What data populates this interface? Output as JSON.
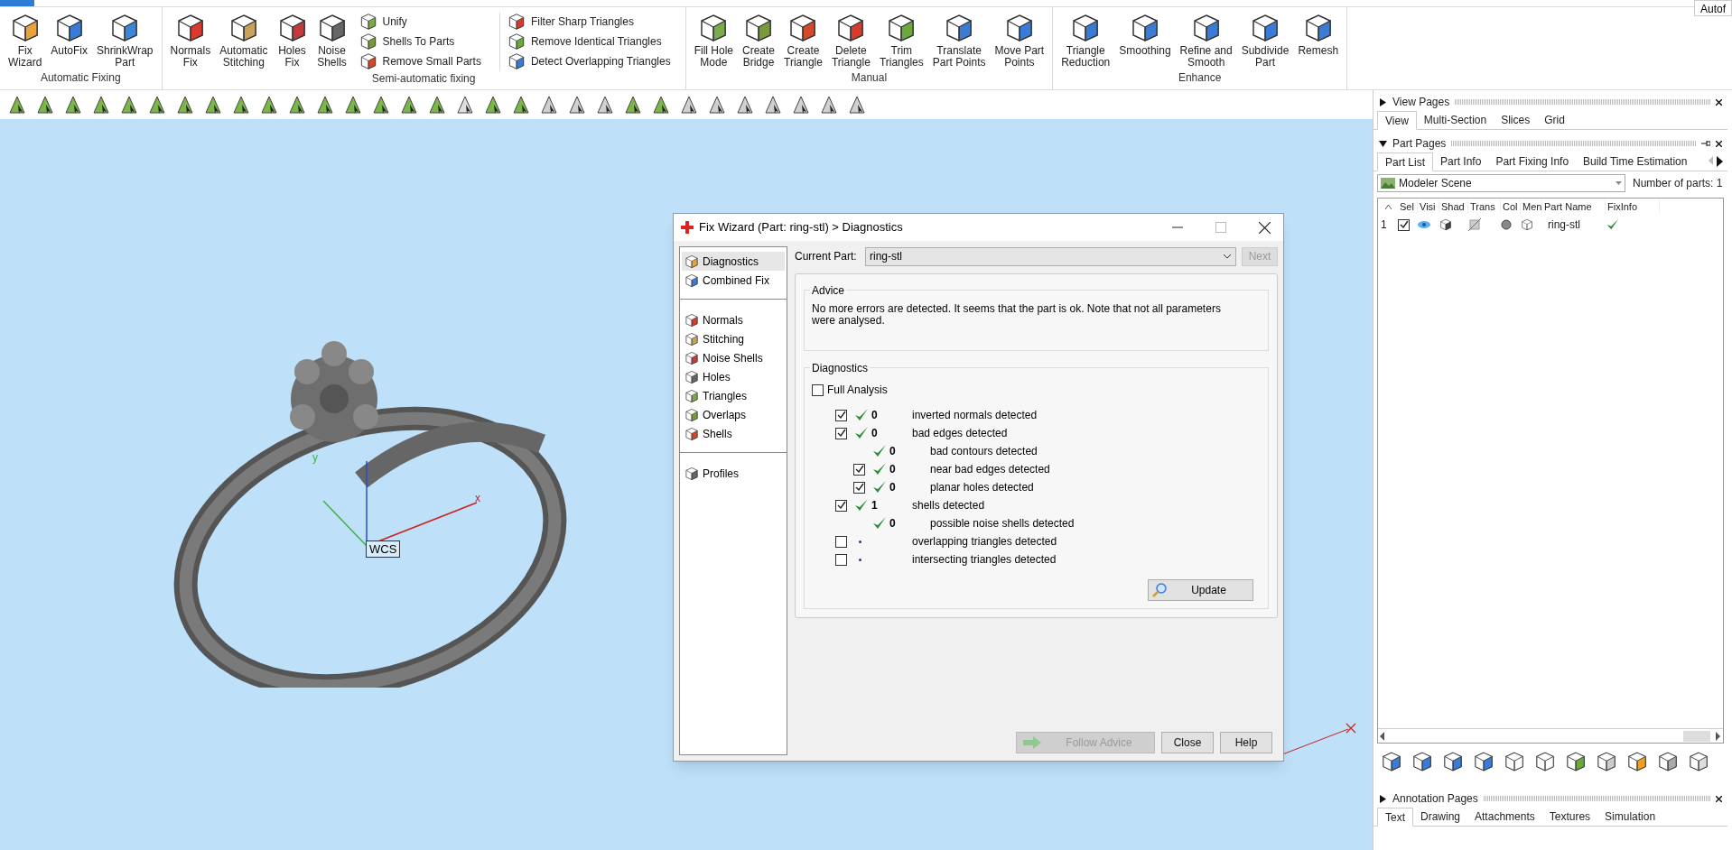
{
  "top_right_tab": "Autof",
  "ribbon": {
    "groups": [
      {
        "label": "Automatic Fixing",
        "large": [
          {
            "lines": [
              "Fix",
              "Wizard"
            ]
          },
          {
            "lines": [
              "AutoFix"
            ]
          },
          {
            "lines": [
              "ShrinkWrap",
              "Part"
            ]
          }
        ]
      },
      {
        "label": "Semi-automatic fixing",
        "large": [
          {
            "lines": [
              "Normals",
              "Fix"
            ]
          },
          {
            "lines": [
              "Automatic",
              "Stitching"
            ]
          },
          {
            "lines": [
              "Holes",
              "Fix"
            ]
          },
          {
            "lines": [
              "Noise",
              "Shells"
            ]
          }
        ],
        "columns": [
          [
            "Unify",
            "Shells To Parts",
            "Remove Small Parts"
          ],
          [
            "Filter Sharp Triangles",
            "Remove Identical Triangles",
            "Detect Overlapping Triangles"
          ]
        ]
      },
      {
        "label": "Manual",
        "large": [
          {
            "lines": [
              "Fill Hole",
              "Mode"
            ]
          },
          {
            "lines": [
              "Create",
              "Bridge"
            ]
          },
          {
            "lines": [
              "Create",
              "Triangle"
            ]
          },
          {
            "lines": [
              "Delete",
              "Triangle"
            ]
          },
          {
            "lines": [
              "Trim",
              "Triangles"
            ]
          },
          {
            "lines": [
              "Translate",
              "Part Points"
            ]
          },
          {
            "lines": [
              "Move Part",
              "Points"
            ]
          }
        ]
      },
      {
        "label": "Enhance",
        "large": [
          {
            "lines": [
              "Triangle",
              "Reduction"
            ]
          },
          {
            "lines": [
              "Smoothing"
            ]
          },
          {
            "lines": [
              "Refine and",
              "Smooth"
            ]
          },
          {
            "lines": [
              "Subdivide",
              "Part"
            ]
          },
          {
            "lines": [
              "Remesh"
            ]
          }
        ]
      }
    ]
  },
  "viewport": {
    "axis_labels": [
      "x",
      "y"
    ],
    "wcs": "WCS"
  },
  "dialog": {
    "title": "Fix Wizard (Part: ring-stl) > Diagnostics",
    "nav": [
      [
        {
          "label": "Diagnostics",
          "selected": true
        },
        {
          "label": "Combined Fix",
          "selected": false
        }
      ],
      [
        {
          "label": "Normals",
          "selected": false
        },
        {
          "label": "Stitching",
          "selected": false
        },
        {
          "label": "Noise Shells",
          "selected": false
        },
        {
          "label": "Holes",
          "selected": false
        },
        {
          "label": "Triangles",
          "selected": false
        },
        {
          "label": "Overlaps",
          "selected": false
        },
        {
          "label": "Shells",
          "selected": false
        }
      ],
      [
        {
          "label": "Profiles",
          "selected": false
        }
      ]
    ],
    "current_part_label": "Current Part:",
    "current_part": "ring-stl",
    "next_button": {
      "label": "Next",
      "disabled": true
    },
    "advice_title": "Advice",
    "advice": "No more errors are detected. It seems that the part is ok. Note that not all parameters were analysed.",
    "diagnostics_title": "Diagnostics",
    "full_analysis": {
      "label": "Full Analysis",
      "checked": false
    },
    "rows": [
      {
        "kind": "check",
        "checked": true,
        "passed": true,
        "count": "0",
        "label": "inverted normals detected"
      },
      {
        "kind": "check",
        "checked": true,
        "passed": true,
        "count": "0",
        "label": "bad edges detected",
        "children": [
          {
            "kind": "plain",
            "passed": true,
            "count": "0",
            "label": "bad contours detected"
          },
          {
            "kind": "check",
            "checked": true,
            "passed": true,
            "count": "0",
            "label": "near bad edges detected"
          },
          {
            "kind": "check",
            "checked": true,
            "passed": true,
            "count": "0",
            "label": "planar holes detected"
          }
        ]
      },
      {
        "kind": "check",
        "checked": true,
        "passed": true,
        "count": "1",
        "label": "shells detected",
        "children": [
          {
            "kind": "plain",
            "passed": true,
            "count": "0",
            "label": "possible noise shells detected"
          }
        ]
      },
      {
        "kind": "check",
        "checked": false,
        "passed": false,
        "label": "overlapping triangles detected"
      },
      {
        "kind": "check",
        "checked": false,
        "passed": false,
        "label": "intersecting triangles detected"
      }
    ],
    "update_button": "Update",
    "footer_buttons": [
      {
        "label": "Follow Advice",
        "disabled": true
      },
      {
        "label": "Close",
        "disabled": false
      },
      {
        "label": "Help",
        "disabled": false
      }
    ]
  },
  "right_panel": {
    "view_pages": {
      "title": "View Pages",
      "expanded": false,
      "tabs": [
        {
          "label": "View",
          "selected": true
        },
        {
          "label": "Multi-Section",
          "selected": false
        },
        {
          "label": "Slices",
          "selected": false
        },
        {
          "label": "Grid",
          "selected": false
        }
      ]
    },
    "part_pages": {
      "title": "Part Pages",
      "expanded": true,
      "tabs": [
        {
          "label": "Part List",
          "selected": true
        },
        {
          "label": "Part Info",
          "selected": false
        },
        {
          "label": "Part Fixing Info",
          "selected": false
        },
        {
          "label": "Build Time Estimation",
          "selected": false
        }
      ],
      "scene": "Modeler Scene",
      "parts_count": "Number of parts: 1",
      "columns": [
        "Sel",
        "Visi",
        "Shad",
        "Trans",
        "Col",
        "Men",
        "Part Name",
        "FixInfo"
      ],
      "rows": [
        {
          "index": "1",
          "selected": true,
          "name": "ring-stl"
        }
      ]
    },
    "annotation_pages": {
      "title": "Annotation Pages",
      "expanded": false,
      "tabs": [
        {
          "label": "Text",
          "selected": true
        },
        {
          "label": "Drawing",
          "selected": false
        },
        {
          "label": "Attachments",
          "selected": false
        },
        {
          "label": "Textures",
          "selected": false
        },
        {
          "label": "Simulation",
          "selected": false
        }
      ]
    }
  }
}
